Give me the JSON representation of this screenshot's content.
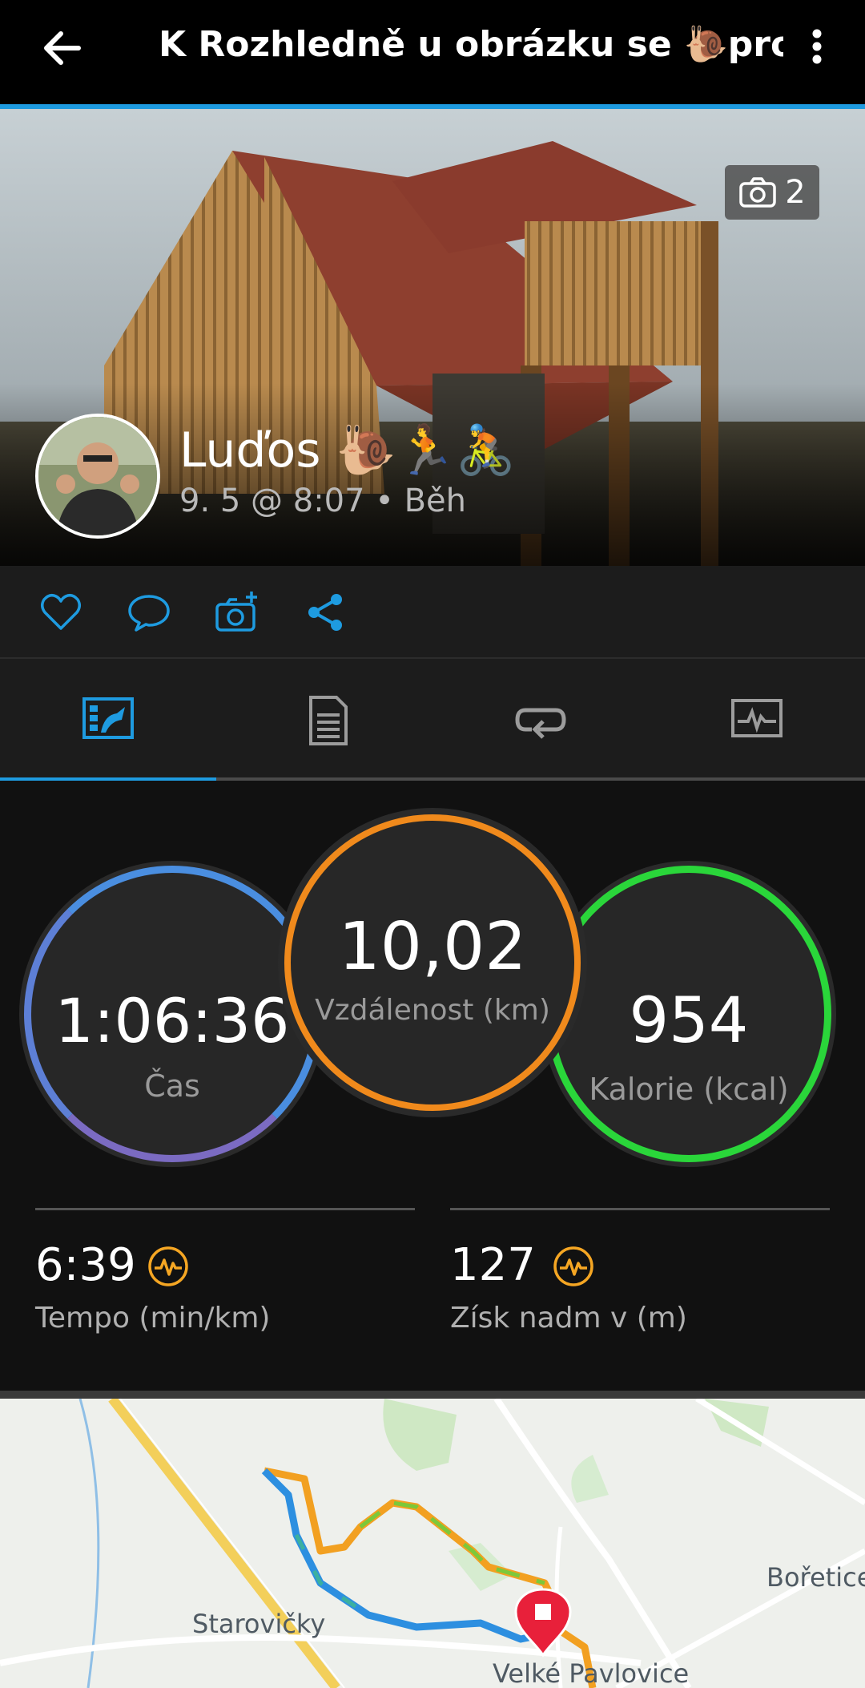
{
  "app_bar": {
    "title": "K Rozhledně u obrázku se 🐌pro ☂️",
    "back_icon": "arrow-back-icon",
    "menu_icon": "more-vert-icon"
  },
  "hero": {
    "photo_count": "2",
    "user_name": "Luďos 🐌🏃🚴",
    "meta": "9. 5 @ 8:07 • Běh"
  },
  "actions": [
    "heart-icon",
    "comment-icon",
    "add-photo-icon",
    "share-icon"
  ],
  "tabs": [
    {
      "name": "stats-tab",
      "icon": "stats-icon",
      "active": true
    },
    {
      "name": "details-tab",
      "icon": "details-icon",
      "active": false
    },
    {
      "name": "laps-tab",
      "icon": "laps-icon",
      "active": false
    },
    {
      "name": "charts-tab",
      "icon": "charts-icon",
      "active": false
    }
  ],
  "stats": {
    "time": {
      "value": "1:06:36",
      "label": "Čas"
    },
    "distance": {
      "value": "10,02",
      "label": "Vzdálenost (km)"
    },
    "calories": {
      "value": "954",
      "label": "Kalorie (kcal)"
    },
    "pace": {
      "value": "6:39",
      "label": "Tempo (min/km)"
    },
    "elevation": {
      "value": "127",
      "label": "Získ nadm v (m)"
    }
  },
  "map": {
    "places": [
      "Bořetice",
      "Starovičky",
      "Velké Pavlovice"
    ]
  },
  "colors": {
    "accent": "#1e9be0",
    "time_ring": "#4a8ee0",
    "distance_ring": "#f08a1c",
    "calories_ring": "#2ad63a",
    "metric_icon": "#f5a623"
  }
}
